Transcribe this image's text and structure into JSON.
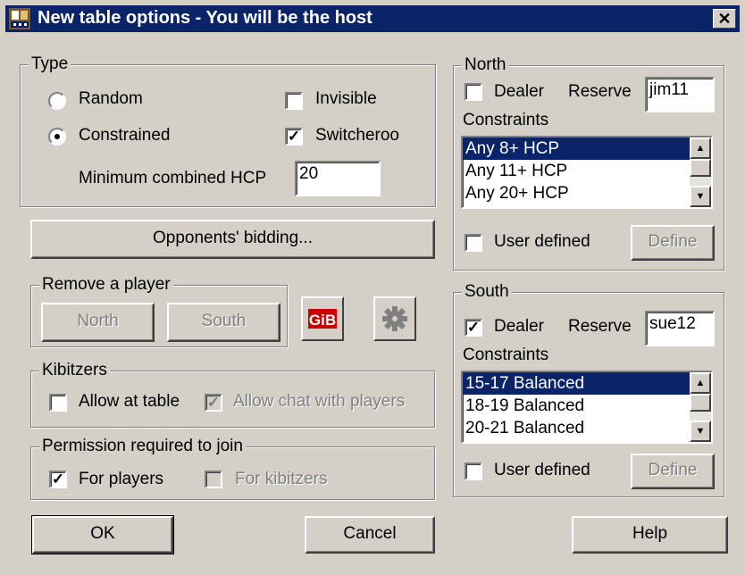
{
  "window": {
    "title": "New table options - You will be the host",
    "icon": "lin-app-icon",
    "close_glyph": "✕"
  },
  "type_group": {
    "label": "Type",
    "random_label": "Random",
    "random_selected": false,
    "constrained_label": "Constrained",
    "constrained_selected": true,
    "invisible_label": "Invisible",
    "invisible_checked": false,
    "switcheroo_label": "Switcheroo",
    "switcheroo_checked": true,
    "min_hcp_label": "Minimum combined HCP",
    "min_hcp_value": "20"
  },
  "opponents_bidding_label": "Opponents' bidding...",
  "remove_player": {
    "label": "Remove a player",
    "north_label": "North",
    "south_label": "South",
    "gib_label": "GiB"
  },
  "kibitzers": {
    "label": "Kibitzers",
    "allow_at_table_label": "Allow at table",
    "allow_at_table_checked": false,
    "allow_chat_label": "Allow chat with players",
    "allow_chat_checked": true
  },
  "permission": {
    "label": "Permission required to join",
    "players_label": "For players",
    "players_checked": true,
    "kibitzers_label": "For kibitzers",
    "kibitzers_checked": false
  },
  "north": {
    "label": "North",
    "dealer_label": "Dealer",
    "dealer_checked": false,
    "reserve_label": "Reserve",
    "reserve_value": "jim11",
    "constraints_label": "Constraints",
    "constraints": [
      "Any 8+ HCP",
      "Any 11+ HCP",
      "Any 20+ HCP"
    ],
    "selected_index": 0,
    "user_defined_label": "User defined",
    "user_defined_checked": false,
    "define_label": "Define"
  },
  "south": {
    "label": "South",
    "dealer_label": "Dealer",
    "dealer_checked": true,
    "reserve_label": "Reserve",
    "reserve_value": "sue12",
    "constraints_label": "Constraints",
    "constraints": [
      "15-17 Balanced",
      "18-19 Balanced",
      "20-21 Balanced"
    ],
    "selected_index": 0,
    "user_defined_label": "User defined",
    "user_defined_checked": false,
    "define_label": "Define"
  },
  "buttons": {
    "ok": "OK",
    "cancel": "Cancel",
    "help": "Help"
  },
  "glyphs": {
    "check": "✓",
    "up_arrow": "▲",
    "down_arrow": "▼"
  },
  "colors": {
    "title_bar": "#0a246a",
    "face": "#d4d0c8",
    "selection": "#0a246a",
    "gib_red": "#cc0000"
  }
}
